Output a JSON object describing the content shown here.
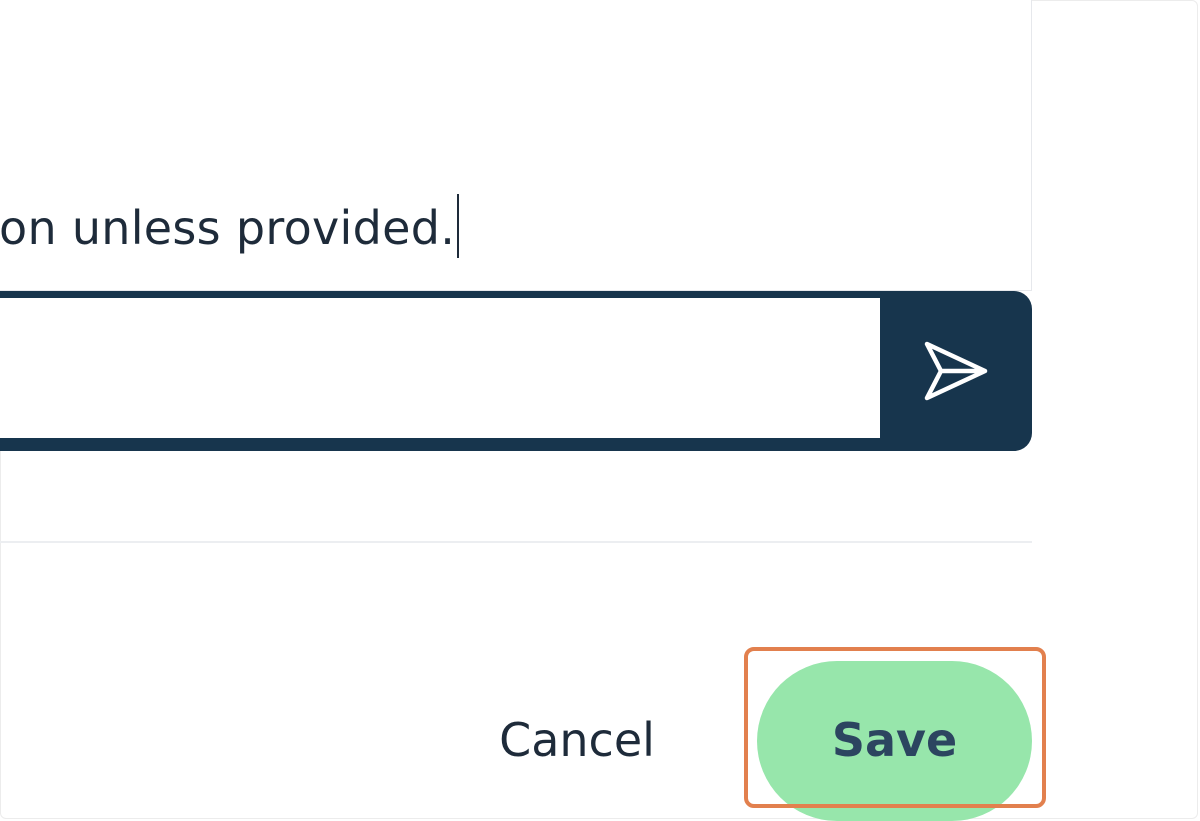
{
  "prompt": {
    "text_visible": "on unless provided."
  },
  "message": {
    "value": "",
    "placeholder": ""
  },
  "send": {
    "icon": "send-paper-plane-icon"
  },
  "actions": {
    "cancel_label": "Cancel",
    "save_label": "Save"
  },
  "colors": {
    "navy": "#17354d",
    "text": "#1e2b3a",
    "save_bg": "#97e6ab",
    "save_text": "#2c4560",
    "highlight": "#e2804e"
  }
}
